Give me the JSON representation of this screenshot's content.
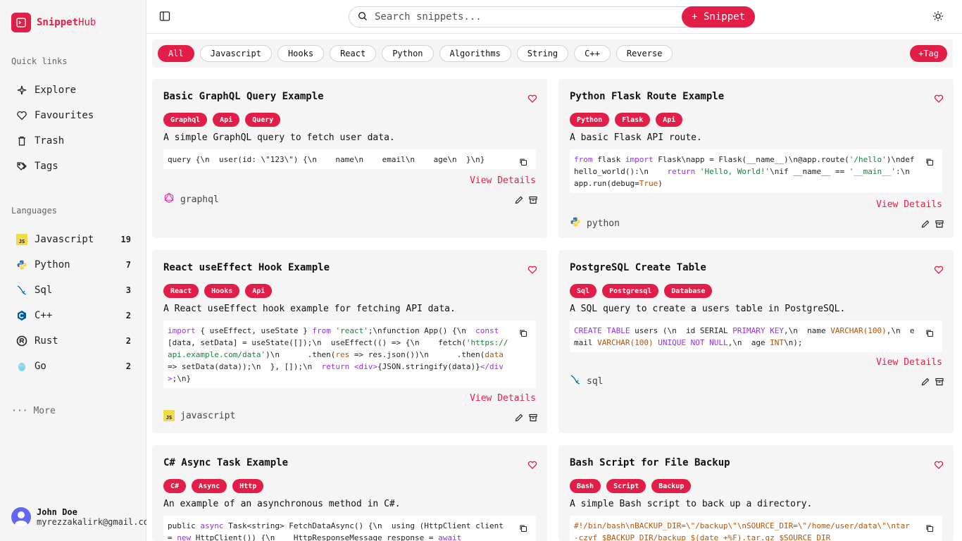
{
  "brand": {
    "name_a": "Snippet",
    "name_b": "Hub"
  },
  "sidebar": {
    "quick_links_title": "Quick links",
    "quick_links": [
      {
        "label": "Explore",
        "icon": "sparkles-icon"
      },
      {
        "label": "Favourites",
        "icon": "heart-icon"
      },
      {
        "label": "Trash",
        "icon": "trash-icon"
      },
      {
        "label": "Tags",
        "icon": "tags-icon"
      }
    ],
    "languages_title": "Languages",
    "languages": [
      {
        "label": "Javascript",
        "count": "19",
        "icon": "javascript-icon"
      },
      {
        "label": "Python",
        "count": "7",
        "icon": "python-icon"
      },
      {
        "label": "Sql",
        "count": "3",
        "icon": "sql-icon"
      },
      {
        "label": "C++",
        "count": "2",
        "icon": "cpp-icon"
      },
      {
        "label": "Rust",
        "count": "2",
        "icon": "rust-icon"
      },
      {
        "label": "Go",
        "count": "2",
        "icon": "go-icon"
      }
    ],
    "more_label": "More",
    "user": {
      "name": "John Doe",
      "email": "myrezzakalirk@gmail.com"
    }
  },
  "topbar": {
    "search_placeholder": "Search snippets...",
    "new_snippet_label": "+ Snippet"
  },
  "tagbar": {
    "tags": [
      "All",
      "Javascript",
      "Hooks",
      "React",
      "Python",
      "Algorithms",
      "String",
      "C++",
      "Reverse"
    ],
    "active": "All",
    "add_tag_label": "+Tag"
  },
  "cards": [
    {
      "title": "Basic GraphQL Query Example",
      "tags": [
        "Graphql",
        "Api",
        "Query"
      ],
      "description": "A simple GraphQL query to fetch user data.",
      "view_label": "View Details",
      "language": "graphql"
    },
    {
      "title": "Python Flask Route Example",
      "tags": [
        "Python",
        "Flask",
        "Api"
      ],
      "description": "A basic Flask API route.",
      "view_label": "View Details",
      "language": "python"
    },
    {
      "title": "React useEffect Hook Example",
      "tags": [
        "React",
        "Hooks",
        "Api"
      ],
      "description": "A React useEffect hook example for fetching API data.",
      "view_label": "View Details",
      "language": "javascript"
    },
    {
      "title": "PostgreSQL Create Table",
      "tags": [
        "Sql",
        "Postgresql",
        "Database"
      ],
      "description": "A SQL query to create a users table in PostgreSQL.",
      "view_label": "View Details",
      "language": "sql"
    },
    {
      "title": "C# Async Task Example",
      "tags": [
        "C#",
        "Async",
        "Http"
      ],
      "description": "An example of an asynchronous method in C#."
    },
    {
      "title": "Bash Script for File Backup",
      "tags": [
        "Bash",
        "Script",
        "Backup"
      ],
      "description": "A simple Bash script to back up a directory."
    }
  ],
  "colors": {
    "accent": "#e11d48"
  }
}
